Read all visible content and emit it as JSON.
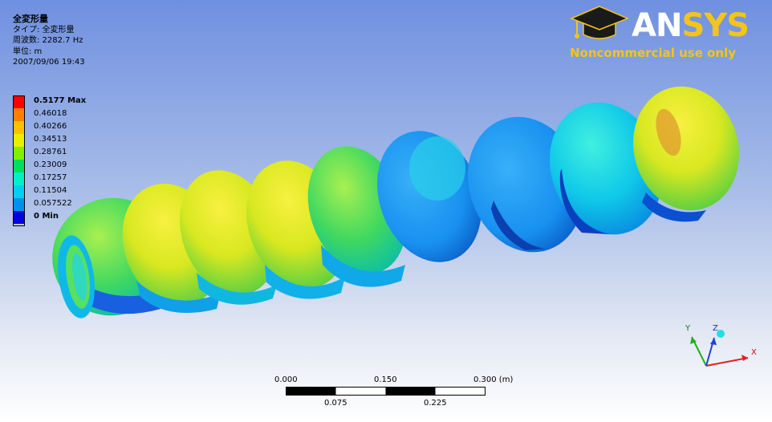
{
  "result_info": {
    "title": "全変形量",
    "type_line": "タイプ: 全変形量",
    "frequency_line": "周波数: 2282.7 Hz",
    "unit_line": "単位: m",
    "timestamp": "2007/09/06 19:43"
  },
  "legend": {
    "entries": [
      {
        "label": "0.5177 Max",
        "color": "#ff0000",
        "bold": true
      },
      {
        "label": "0.46018",
        "color": "#ff8000",
        "bold": false
      },
      {
        "label": "0.40266",
        "color": "#ffc000",
        "bold": false
      },
      {
        "label": "0.34513",
        "color": "#e8f000",
        "bold": false
      },
      {
        "label": "0.28761",
        "color": "#80f000",
        "bold": false
      },
      {
        "label": "0.23009",
        "color": "#00e060",
        "bold": false
      },
      {
        "label": "0.17257",
        "color": "#00f0c8",
        "bold": false
      },
      {
        "label": "0.11504",
        "color": "#00d0f0",
        "bold": false
      },
      {
        "label": "0.057522",
        "color": "#0090f0",
        "bold": false
      },
      {
        "label": "0 Min",
        "color": "#0000e0",
        "bold": true
      }
    ]
  },
  "logo": {
    "brand_a": "AN",
    "brand_b": "SYS",
    "subtitle": "Noncommercial use only"
  },
  "scale_bar": {
    "top_labels": [
      "0.000",
      "0.150",
      "0.300 (m)"
    ],
    "bottom_labels": [
      "0.075",
      "0.225"
    ]
  },
  "triad": {
    "x_label": "X",
    "y_label": "Y",
    "z_label": "Z"
  }
}
